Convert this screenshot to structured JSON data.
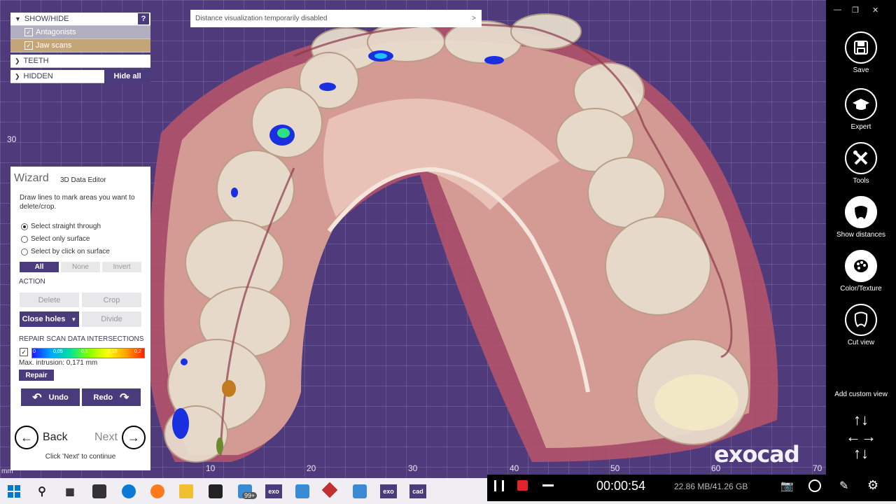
{
  "viewport": {
    "banner": "Distance visualization temporarily disabled",
    "banner_arrow": ">",
    "axis_labels_x": [
      "10",
      "20",
      "30",
      "40",
      "50",
      "60",
      "70"
    ],
    "axis_label_y": "30",
    "axis_unit": "mm",
    "logo": "exocad"
  },
  "showhide": {
    "header": "SHOW/HIDE",
    "help": "?",
    "items": [
      {
        "label": "Antagonists",
        "checked": true
      },
      {
        "label": "Jaw scans",
        "checked": true
      }
    ],
    "teeth": "TEETH",
    "hidden": "HIDDEN",
    "hide_all": "Hide all"
  },
  "wizard": {
    "title": "Wizard",
    "subtitle": "3D Data Editor",
    "description": "Draw lines to mark areas you want to delete/crop.",
    "radios": [
      {
        "label": "Select straight through",
        "selected": true
      },
      {
        "label": "Select only surface",
        "selected": false
      },
      {
        "label": "Select by click on surface",
        "selected": false
      }
    ],
    "segments": [
      "All",
      "None",
      "Invert"
    ],
    "action_label": "ACTION",
    "delete": "Delete",
    "crop": "Crop",
    "close_holes": "Close holes",
    "divide": "Divide",
    "repair_label": "REPAIR SCAN DATA INTERSECTIONS",
    "colorbar_ticks": [
      "0",
      "0,05",
      "0,1",
      "0,15",
      "0,2"
    ],
    "max_intrusion": "Max. intrusion:  0,171 mm",
    "repair": "Repair",
    "undo": "Undo",
    "redo": "Redo",
    "back": "Back",
    "next": "Next",
    "hint": "Click 'Next' to continue"
  },
  "toolbar": {
    "save": "Save",
    "expert": "Expert",
    "tools": "Tools",
    "show_distances": "Show distances",
    "color_texture": "Color/Texture",
    "cut_view": "Cut view",
    "add_custom_view": "Add custom view"
  },
  "taskbar": {
    "mail_badge": "99+",
    "exo1": "exo",
    "exo2": "exo",
    "cad": "cad"
  },
  "recorder": {
    "time": "00:00:54",
    "storage": "22.86 MB/41.26 GB"
  }
}
